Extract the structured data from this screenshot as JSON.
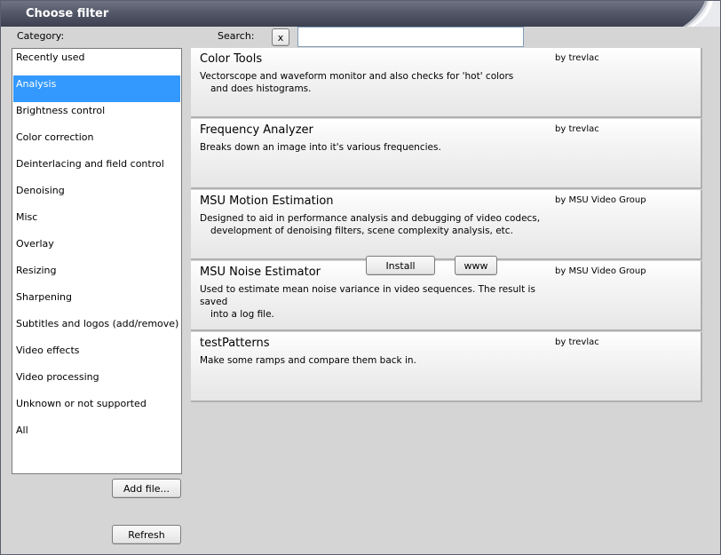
{
  "window": {
    "title": "Choose filter"
  },
  "labels": {
    "category": "Category:",
    "search": "Search:"
  },
  "search": {
    "clear_label": "x",
    "value": "",
    "placeholder": ""
  },
  "categories": [
    {
      "label": "Recently used",
      "selected": false
    },
    {
      "label": "Analysis",
      "selected": true
    },
    {
      "label": "Brightness control",
      "selected": false
    },
    {
      "label": "Color correction",
      "selected": false
    },
    {
      "label": "Deinterlacing and field control",
      "selected": false
    },
    {
      "label": "Denoising",
      "selected": false
    },
    {
      "label": "Misc",
      "selected": false
    },
    {
      "label": "Overlay",
      "selected": false
    },
    {
      "label": "Resizing",
      "selected": false
    },
    {
      "label": "Sharpening",
      "selected": false
    },
    {
      "label": "Subtitles and logos (add/remove)",
      "selected": false
    },
    {
      "label": "Video effects",
      "selected": false
    },
    {
      "label": "Video processing",
      "selected": false
    },
    {
      "label": "Unknown or not supported",
      "selected": false
    },
    {
      "label": "All",
      "selected": false
    }
  ],
  "buttons": {
    "add_file": "Add file...",
    "refresh": "Refresh",
    "install": "Install",
    "www": "www"
  },
  "filters": [
    {
      "name": "Color Tools",
      "author": "by trevlac",
      "desc_line1": "Vectorscope and waveform monitor and also checks for 'hot' colors",
      "desc_line2": "and does histograms."
    },
    {
      "name": "Frequency Analyzer",
      "author": "by trevlac",
      "desc_line1": "Breaks down an image into it's various frequencies.",
      "desc_line2": ""
    },
    {
      "name": "MSU Motion Estimation",
      "author": "by MSU Video Group",
      "desc_line1": "Designed to aid in performance analysis and debugging of video codecs,",
      "desc_line2": "development of denoising filters, scene complexity analysis, etc."
    },
    {
      "name": "MSU Noise Estimator",
      "author": "by MSU Video Group",
      "desc_line1": "Used to estimate mean noise variance in video sequences. The result is saved",
      "desc_line2": "into a log file."
    },
    {
      "name": "testPatterns",
      "author": "by trevlac",
      "desc_line1": "Make some ramps and compare them back in.",
      "desc_line2": ""
    }
  ],
  "colors": {
    "selection": "#3399ff",
    "titlebar": "#545969",
    "background": "#d5d5d5"
  }
}
